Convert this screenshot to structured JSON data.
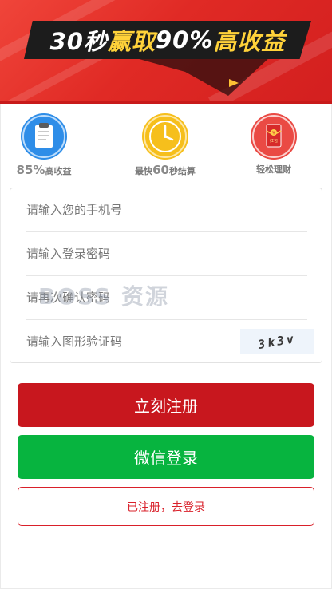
{
  "banner": {
    "headline_part1": "30秒",
    "headline_part2": "赢取",
    "headline_part3": "90%",
    "headline_part4": "高收益",
    "colors": {
      "background": "#e02a25",
      "gold": "#ffd23a"
    }
  },
  "features": [
    {
      "icon": "clipboard-icon",
      "value": "85%",
      "label": "高收益"
    },
    {
      "icon": "clock-icon",
      "prefix": "最快",
      "value": "60",
      "label": "秒结算"
    },
    {
      "icon": "red-envelope-icon",
      "envelope_text": "红包",
      "label": "轻松理财"
    }
  ],
  "form": {
    "phone_placeholder": "请输入您的手机号",
    "password_placeholder": "请输入登录密码",
    "confirm_placeholder": "请再次确认密码",
    "captcha_placeholder": "请输入图形验证码",
    "captcha_text": "3k3v"
  },
  "buttons": {
    "register": "立刻注册",
    "wechat": "微信登录",
    "login": "已注册，去登录"
  },
  "watermark": "BOSS 资源",
  "colors": {
    "register": "#c8171e",
    "wechat": "#07b43f",
    "login_border": "#d9202a"
  }
}
